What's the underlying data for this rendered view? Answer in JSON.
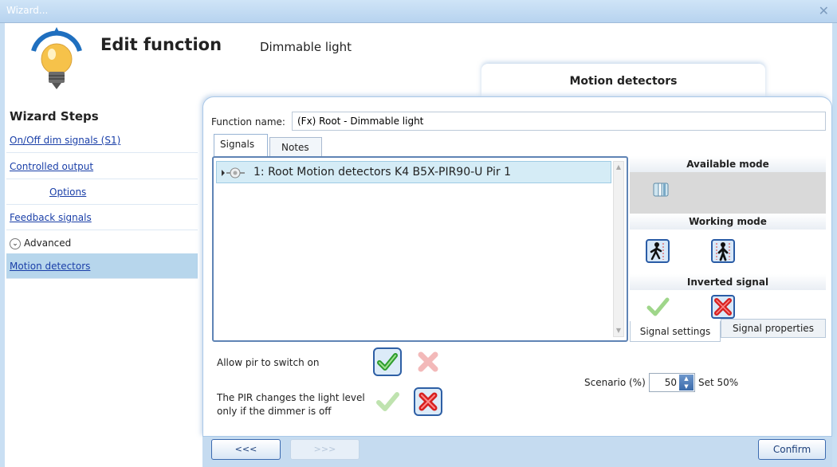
{
  "window": {
    "title": "Wizard..."
  },
  "header": {
    "title": "Edit function",
    "subtitle": "Dimmable light",
    "tab": "Motion detectors"
  },
  "wizard": {
    "heading": "Wizard Steps",
    "steps": [
      {
        "label": "On/Off dim signals (S1)"
      },
      {
        "label": "Controlled output"
      },
      {
        "label": "Options"
      },
      {
        "label": "Feedback signals"
      },
      {
        "label": "Advanced"
      },
      {
        "label": "Motion detectors"
      }
    ]
  },
  "function": {
    "name_label": "Function name:",
    "name_value": "(Fx) Root - Dimmable light"
  },
  "tabs": {
    "signals": "Signals",
    "notes": "Notes"
  },
  "signals": [
    {
      "label": "1: Root Motion detectors K4 B5X-PIR90-U Pir 1"
    }
  ],
  "modes": {
    "available_title": "Available mode",
    "working_title": "Working mode",
    "inverted_title": "Inverted signal"
  },
  "subtabs": {
    "settings": "Signal settings",
    "properties": "Signal properties"
  },
  "options": {
    "allow_pir": "Allow pir to switch on",
    "pir_changes_line1": "The PIR changes the light level",
    "pir_changes_line2": "only if the dimmer is off"
  },
  "scenario": {
    "label": "Scenario (%)",
    "value": "50",
    "set_label": "Set 50%"
  },
  "footer": {
    "prev": "<<<",
    "next": ">>>",
    "confirm": "Confirm"
  },
  "colors": {
    "accent": "#2e5fa5",
    "titlebar": "#b7d3ef",
    "active_step": "#b7d6ec"
  }
}
